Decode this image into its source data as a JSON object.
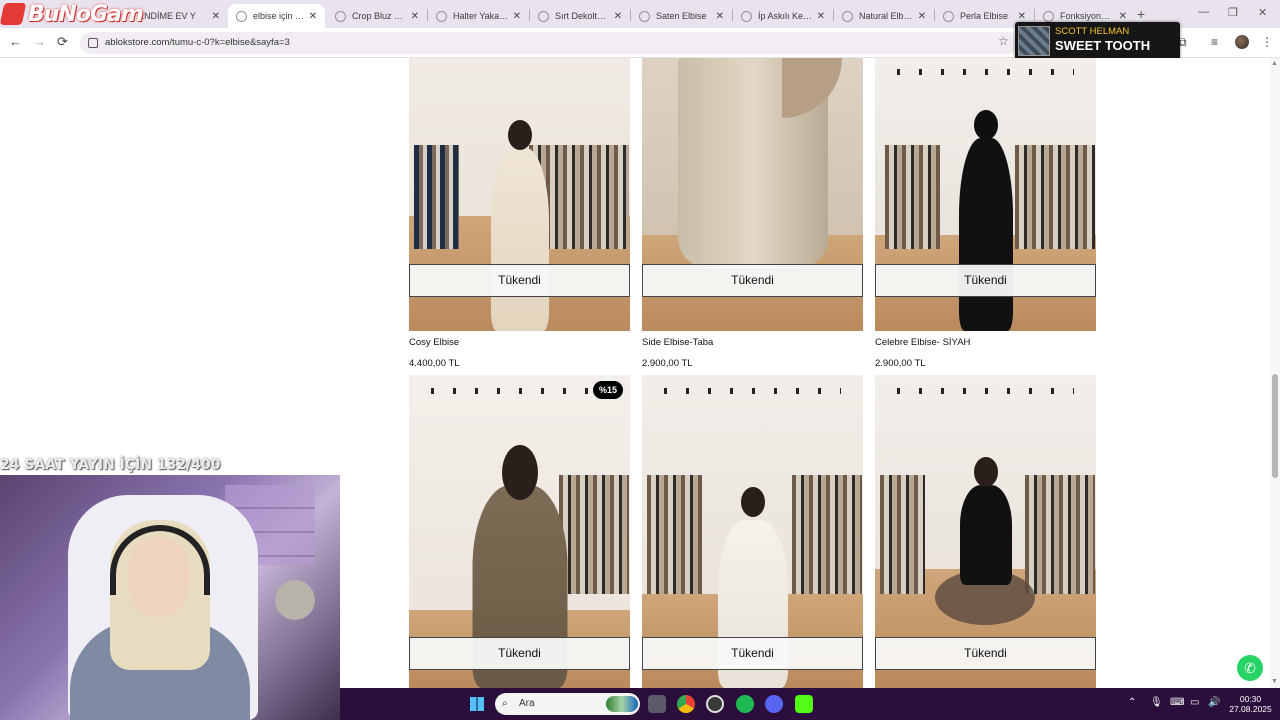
{
  "logo": {
    "text": "BuNoGam"
  },
  "browser": {
    "tabs": [
      {
        "label": "ENDİME EV Y",
        "close": "✕"
      },
      {
        "label": "elbise için aran",
        "close": "✕"
      },
      {
        "label": "Crop Bluz Haki",
        "close": "✕"
      },
      {
        "label": "Halter Yakalı D",
        "close": "✕"
      },
      {
        "label": "Sırt Dekolteli İp",
        "close": "✕"
      },
      {
        "label": "Saten Elbise",
        "close": "✕"
      },
      {
        "label": "İp Askılı Keten",
        "close": "✕"
      },
      {
        "label": "Natural Elbise",
        "close": "✕"
      },
      {
        "label": "Perla Elbise",
        "close": "✕"
      },
      {
        "label": "Fonksiyonel İp",
        "close": "✕"
      }
    ],
    "active_tab_index": 1,
    "new_tab": "+",
    "url": "ablokstore.com/tumu-c-0?k=elbise&sayfa=3",
    "nav": {
      "back": "←",
      "forward": "→",
      "reload": "⟳"
    },
    "window_controls": {
      "minimize": "—",
      "restore": "❐",
      "close": "✕"
    }
  },
  "now_playing": {
    "artist": "SCOTT HELMAN",
    "song": "SWEET TOOTH"
  },
  "products": [
    {
      "name": "Cosy Elbise",
      "price": "4.400,00 TL",
      "status": "Tükendi",
      "badge": ""
    },
    {
      "name": "Side Elbise-Taba",
      "price": "2.900,00 TL",
      "status": "Tükendi",
      "badge": ""
    },
    {
      "name": "Celebre Elbise- SİYAH",
      "price": "2.900,00 TL",
      "status": "Tükendi",
      "badge": ""
    },
    {
      "name": "",
      "price": "",
      "status": "Tükendi",
      "badge": "%15"
    },
    {
      "name": "",
      "price": "",
      "status": "Tükendi",
      "badge": ""
    },
    {
      "name": "",
      "price": "",
      "status": "Tükendi",
      "badge": ""
    }
  ],
  "stream": {
    "overlay_text": "24 SAAT YAYIN İÇİN 132/400"
  },
  "taskbar": {
    "search_placeholder": "Ara",
    "time": "00:30",
    "date": "27.08.2025"
  },
  "colors": {
    "tabstrip": "#e9e3ee",
    "taskbar": "#2b0e3c",
    "whatsapp": "#25d366",
    "badge": "#000000"
  }
}
